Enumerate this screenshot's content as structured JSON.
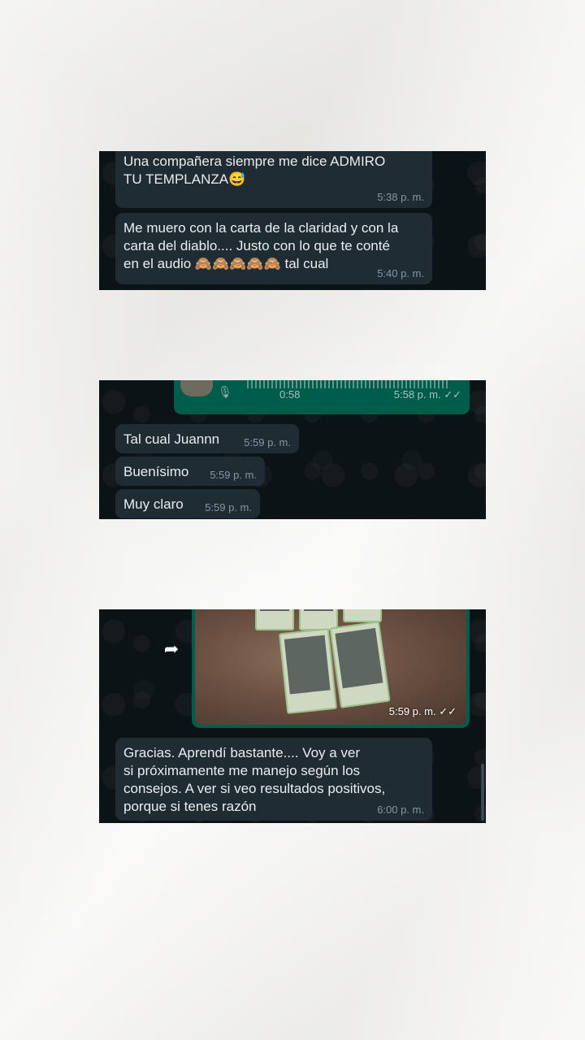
{
  "screens": [
    {
      "messages": [
        {
          "text": "Una compañera siempre me dice ADMIRO\nTU TEMPLANZA",
          "emoji": "😅",
          "time": "5:38 p. m."
        },
        {
          "text": "Me muero con la carta de la claridad y con la\ncarta del diablo.... Justo con lo que te conté\nen el audio ",
          "emoji": "🙈🙈🙈🙈🙈",
          "suffix": " tal cual",
          "time": "5:40 p. m."
        }
      ]
    },
    {
      "audio": {
        "duration": "0:58",
        "time": "5:58 p. m.",
        "ticks": "✓✓"
      },
      "messages": [
        {
          "text": "Tal cual Juannn",
          "time": "5:59 p. m."
        },
        {
          "text": "Buenísimo",
          "time": "5:59 p. m."
        },
        {
          "text": "Muy claro",
          "time": "5:59 p. m."
        }
      ]
    },
    {
      "image": {
        "time": "5:59 p. m.",
        "ticks": "✓✓"
      },
      "icons": {
        "forward": "forward-arrow-icon"
      },
      "messages": [
        {
          "text": "Gracias. Aprendí bastante.... Voy a ver\nsi próximamente me manejo según los\nconsejos. A ver si veo resultados positivos,\nporque si tenes razón",
          "time": "6:00 p. m."
        }
      ]
    }
  ],
  "colors": {
    "background": "#f2f1ee",
    "chat_bg": "#0c1316",
    "incoming_bubble": "#202c33",
    "outgoing_bubble": "#005c4b",
    "text": "#e9edef",
    "timestamp": "#8696a0"
  }
}
